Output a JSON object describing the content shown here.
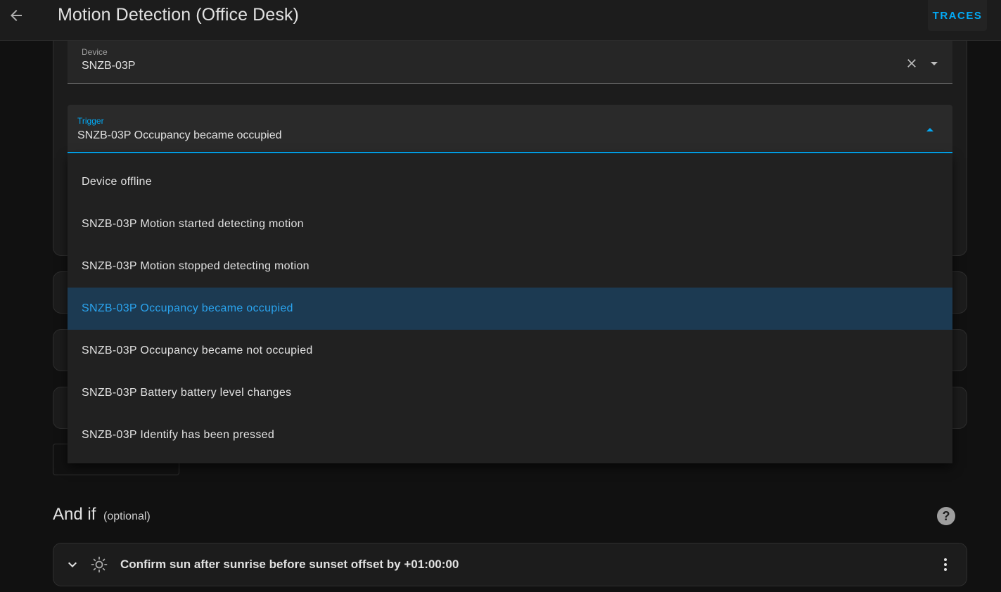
{
  "header": {
    "title": "Motion Detection (Office Desk)",
    "traces_label": "TRACES"
  },
  "device_field": {
    "label": "Device",
    "value": "SNZB-03P"
  },
  "trigger_field": {
    "label": "Trigger",
    "value": "SNZB-03P Occupancy became occupied"
  },
  "trigger_menu": {
    "items": [
      {
        "label": "Device offline",
        "selected": false
      },
      {
        "label": "SNZB-03P Motion started detecting motion",
        "selected": false
      },
      {
        "label": "SNZB-03P Motion stopped detecting motion",
        "selected": false
      },
      {
        "label": "SNZB-03P Occupancy became occupied",
        "selected": true
      },
      {
        "label": "SNZB-03P Occupancy became not occupied",
        "selected": false
      },
      {
        "label": "SNZB-03P Battery battery level changes",
        "selected": false
      },
      {
        "label": "SNZB-03P Identify has been pressed",
        "selected": false
      }
    ]
  },
  "conditions_section": {
    "heading": "And if",
    "optional_label": "(optional)",
    "conditions": [
      {
        "text": "Confirm sun after sunrise before sunset offset by +01:00:00",
        "icon": "sun-icon"
      }
    ]
  },
  "colors": {
    "accent": "#03a9f4",
    "selected_bg": "#1c3a52",
    "background": "#111111",
    "surface": "#1c1c1c"
  }
}
